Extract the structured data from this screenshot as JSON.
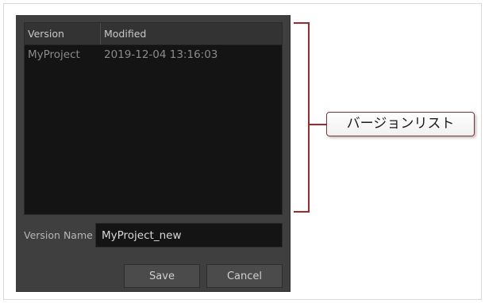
{
  "dialog": {
    "columns": {
      "version": "Version",
      "modified": "Modified"
    },
    "rows": [
      {
        "version": "MyProject",
        "modified": "2019-12-04 13:16:03"
      }
    ],
    "version_name_label": "Version Name",
    "version_name_value": "MyProject_new",
    "save_label": "Save",
    "cancel_label": "Cancel"
  },
  "annotation": {
    "callout_text": "バージョンリスト",
    "accent_color": "#9b2a2a"
  }
}
